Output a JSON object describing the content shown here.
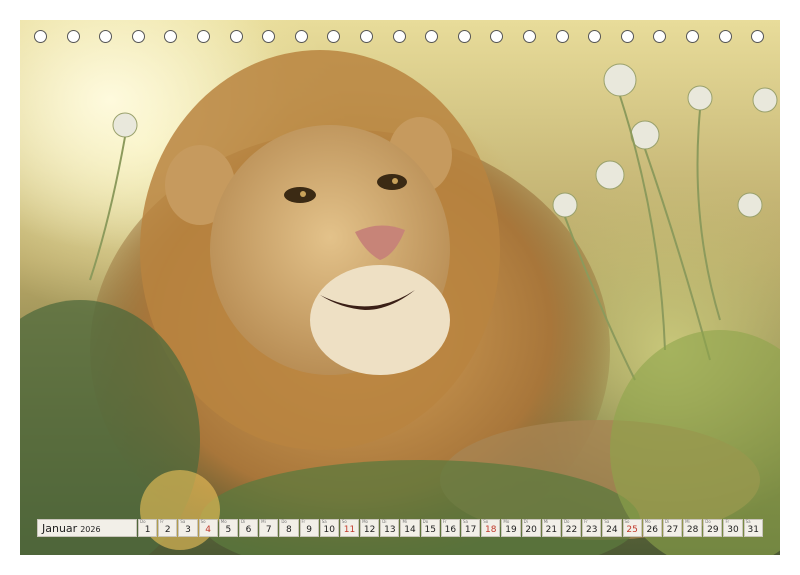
{
  "month": {
    "name": "Januar",
    "year": "2026"
  },
  "days": [
    {
      "n": "1",
      "w": "Do",
      "sun": false
    },
    {
      "n": "2",
      "w": "Fr",
      "sun": false
    },
    {
      "n": "3",
      "w": "Sa",
      "sun": false
    },
    {
      "n": "4",
      "w": "So",
      "sun": true
    },
    {
      "n": "5",
      "w": "Mo",
      "sun": false
    },
    {
      "n": "6",
      "w": "Di",
      "sun": false
    },
    {
      "n": "7",
      "w": "Mi",
      "sun": false
    },
    {
      "n": "8",
      "w": "Do",
      "sun": false
    },
    {
      "n": "9",
      "w": "Fr",
      "sun": false
    },
    {
      "n": "10",
      "w": "Sa",
      "sun": false
    },
    {
      "n": "11",
      "w": "So",
      "sun": true
    },
    {
      "n": "12",
      "w": "Mo",
      "sun": false
    },
    {
      "n": "13",
      "w": "Di",
      "sun": false
    },
    {
      "n": "14",
      "w": "Mi",
      "sun": false
    },
    {
      "n": "15",
      "w": "Do",
      "sun": false
    },
    {
      "n": "16",
      "w": "Fr",
      "sun": false
    },
    {
      "n": "17",
      "w": "Sa",
      "sun": false
    },
    {
      "n": "18",
      "w": "So",
      "sun": true
    },
    {
      "n": "19",
      "w": "Mo",
      "sun": false
    },
    {
      "n": "20",
      "w": "Di",
      "sun": false
    },
    {
      "n": "21",
      "w": "Mi",
      "sun": false
    },
    {
      "n": "22",
      "w": "Do",
      "sun": false
    },
    {
      "n": "23",
      "w": "Fr",
      "sun": false
    },
    {
      "n": "24",
      "w": "Sa",
      "sun": false
    },
    {
      "n": "25",
      "w": "So",
      "sun": true
    },
    {
      "n": "26",
      "w": "Mo",
      "sun": false
    },
    {
      "n": "27",
      "w": "Di",
      "sun": false
    },
    {
      "n": "28",
      "w": "Mi",
      "sun": false
    },
    {
      "n": "29",
      "w": "Do",
      "sun": false
    },
    {
      "n": "30",
      "w": "Fr",
      "sun": false
    },
    {
      "n": "31",
      "w": "Sa",
      "sun": false
    }
  ],
  "colors": {
    "sunday": "#c0392b",
    "cell": "#f2efe8"
  }
}
